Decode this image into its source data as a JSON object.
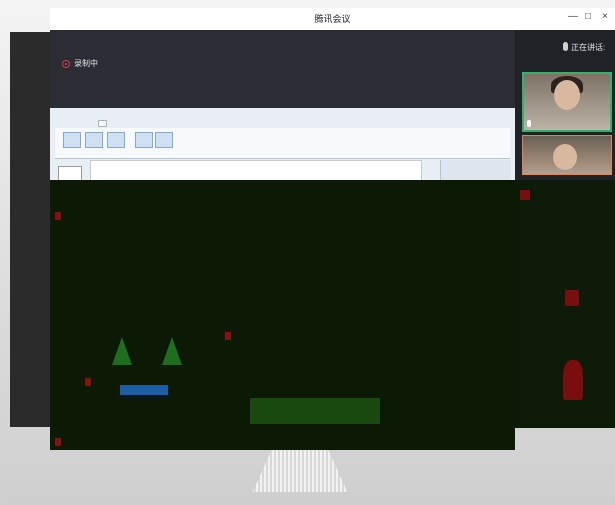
{
  "window": {
    "title": "腾讯会议",
    "minimize_icon": "minimize-icon",
    "maximize_icon": "maximize-icon",
    "close_icon": "close-icon"
  },
  "recording": {
    "label": "录制中",
    "icon": "record-icon"
  },
  "speaker": {
    "label": "正在讲话:"
  },
  "participants": [
    {
      "name": "",
      "mic_icon": "mic-icon"
    },
    {
      "name": "",
      "mic_icon": "mic-icon"
    }
  ],
  "shared_screen": {
    "app_title": "",
    "ribbon_tabs": [
      "",
      "",
      "",
      "",
      "",
      "",
      "",
      "",
      "",
      ""
    ]
  },
  "colors": {
    "speaking_border": "#30b36a",
    "record_red": "#d83b3b",
    "app_background": "#1d1f24"
  }
}
